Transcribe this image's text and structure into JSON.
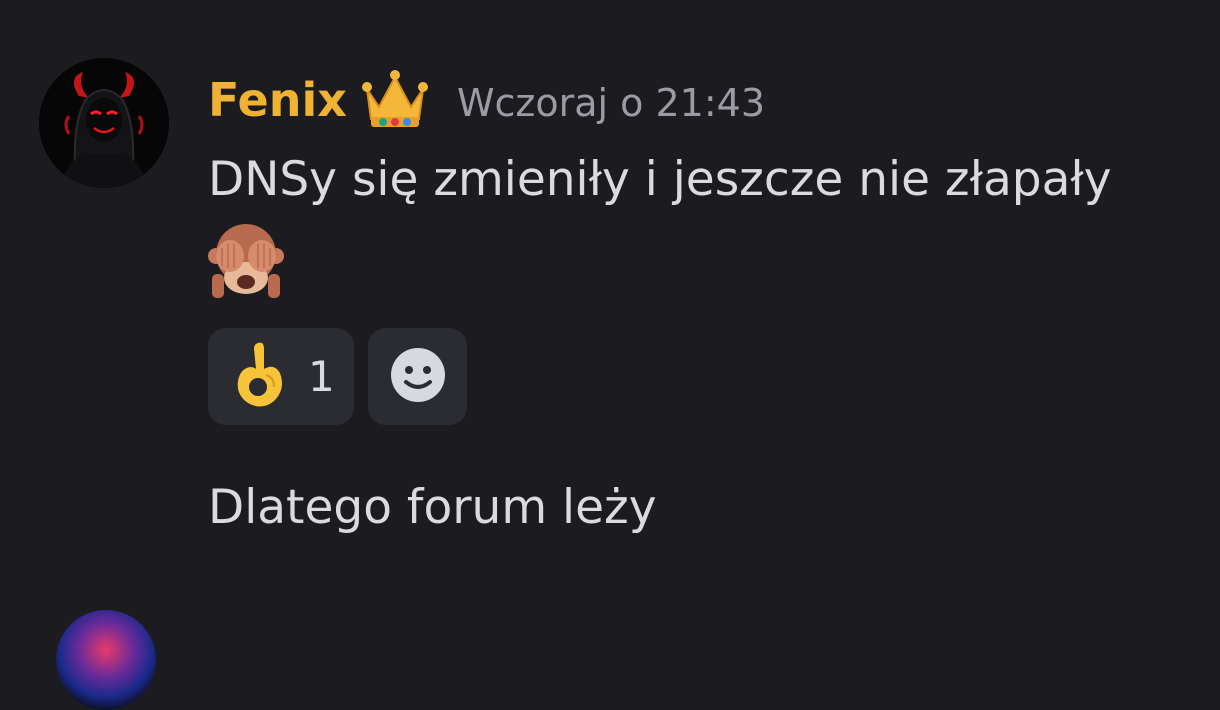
{
  "message": {
    "author": "Fenix",
    "author_color": "#f0b232",
    "badge_icon": "crown-icon",
    "timestamp": "Wczoraj o 21:43",
    "lines": [
      "DNSy się zmieniły i jeszcze nie złapały",
      "Dlatego forum leży"
    ],
    "inline_emoji": "see-no-evil-monkey-icon",
    "reactions": [
      {
        "emoji": "ok-hand-icon",
        "count": "1"
      }
    ],
    "add_reaction_icon": "smiley-add-reaction-icon"
  },
  "colors": {
    "background": "#1c1c20",
    "text": "#dadbe0",
    "muted": "#9a9ba3",
    "reaction_bg": "#2b2c31"
  }
}
